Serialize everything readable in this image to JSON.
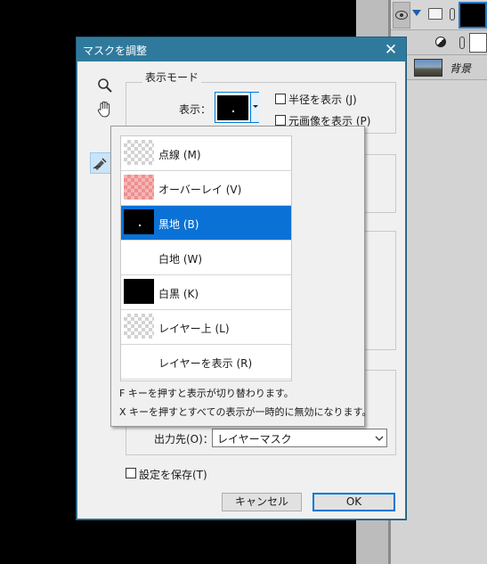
{
  "layers_panel": {
    "background_layer_name": "背景"
  },
  "dialog": {
    "title": "マスクを調整",
    "close_glyph": "✕",
    "view_mode_group_label": "表示モード",
    "view_label": "表示：",
    "show_radius_label": "半径を表示 (J)",
    "show_original_label": "元画像を表示 (P)",
    "output_to_label": "出力先(O)：",
    "output_to_value": "レイヤーマスク",
    "remember_settings_label": "設定を保存(T)",
    "cancel_label": "キャンセル",
    "ok_label": "OK"
  },
  "view_options": [
    {
      "label": "点線 (M)",
      "swatch": "checker",
      "selected": false
    },
    {
      "label": "オーバーレイ (V)",
      "swatch": "red",
      "selected": false
    },
    {
      "label": "黒地 (B)",
      "swatch": "black",
      "selected": true
    },
    {
      "label": "白地 (W)",
      "swatch": "white",
      "selected": false
    },
    {
      "label": "白黒 (K)",
      "swatch": "black",
      "selected": false
    },
    {
      "label": "レイヤー上 (L)",
      "swatch": "checker",
      "selected": false
    },
    {
      "label": "レイヤーを表示 (R)",
      "swatch": "white",
      "selected": false
    }
  ],
  "hints": {
    "f_key": "F キーを押すと表示が切り替わります。",
    "x_key": "X キーを押すとすべての表示が一時的に無効になります。"
  },
  "colors": {
    "titlebar": "#2f7a9c",
    "selection": "#0a72d6",
    "ok_border": "#0078d7"
  }
}
